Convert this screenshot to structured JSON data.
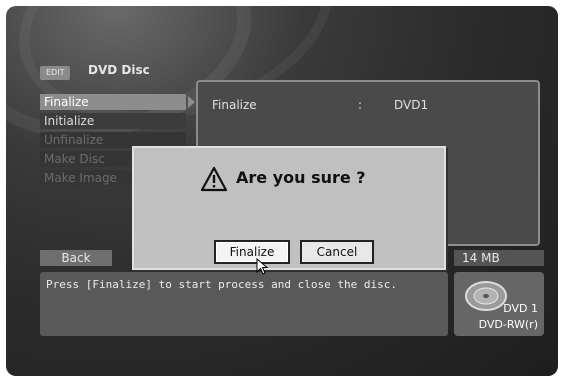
{
  "header": {
    "badge": "EDIT",
    "title": "DVD Disc"
  },
  "menu": {
    "items": [
      {
        "label": "Finalize"
      },
      {
        "label": "Initialize"
      },
      {
        "label": "Unfinalize"
      },
      {
        "label": "Make Disc"
      },
      {
        "label": "Make Image"
      }
    ]
  },
  "info": {
    "label": "Finalize",
    "separator": ":",
    "value": "DVD1"
  },
  "bottom": {
    "back_label": "Back",
    "capacity": "14 MB",
    "status_message": "Press [Finalize] to start process and close the disc.",
    "disc_name": "DVD 1",
    "disc_type": "DVD-RW(r)"
  },
  "dialog": {
    "message": "Are you sure ?",
    "confirm_label": "Finalize",
    "cancel_label": "Cancel",
    "icon": "warning-icon"
  },
  "colors": {
    "background": "#2a2a2a",
    "selected": "#8d8d8d",
    "dialog": "#c0c0c0"
  }
}
